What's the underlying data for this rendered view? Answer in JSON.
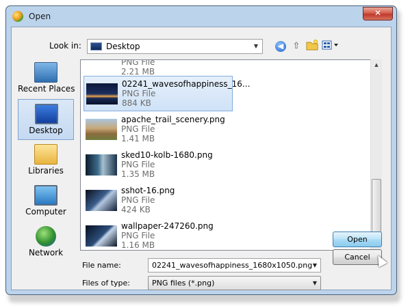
{
  "window": {
    "title": "Open",
    "close_symbol": "✕"
  },
  "toolbar": {
    "look_in_label": "Look in:",
    "look_in_value": "Desktop",
    "back_icon": "back-arrow-icon",
    "up_icon": "up-folder-icon",
    "new_folder_icon": "new-folder-icon",
    "views_icon": "views-menu-icon"
  },
  "places": [
    {
      "label": "Recent Places",
      "icon": "recent-places-icon"
    },
    {
      "label": "Desktop",
      "icon": "desktop-icon",
      "selected": true
    },
    {
      "label": "Libraries",
      "icon": "libraries-icon"
    },
    {
      "label": "Computer",
      "icon": "computer-icon"
    },
    {
      "label": "Network",
      "icon": "network-icon"
    }
  ],
  "files": [
    {
      "name": "",
      "type": "PNG File",
      "size": "2.21 MB"
    },
    {
      "name": "02241_wavesofhappiness_16...",
      "type": "PNG File",
      "size": "884 KB",
      "selected": true
    },
    {
      "name": "apache_trail_scenery.png",
      "type": "PNG File",
      "size": "1.41 MB"
    },
    {
      "name": "sked10-kolb-1680.png",
      "type": "PNG File",
      "size": "1.35 MB"
    },
    {
      "name": "sshot-16.png",
      "type": "PNG File",
      "size": "424 KB"
    },
    {
      "name": "wallpaper-247260.png",
      "type": "PNG File",
      "size": "1.16 MB"
    }
  ],
  "form": {
    "file_name_label": "File name:",
    "file_name_value": "02241_wavesofhappiness_1680x1050.png",
    "file_type_label": "Files of type:",
    "file_type_value": "PNG files (*.png)"
  },
  "buttons": {
    "open": "Open",
    "cancel": "Cancel"
  },
  "colors": {
    "accent": "#3c7fb1",
    "selection": "#cfe2f7",
    "close": "#c0392b"
  }
}
